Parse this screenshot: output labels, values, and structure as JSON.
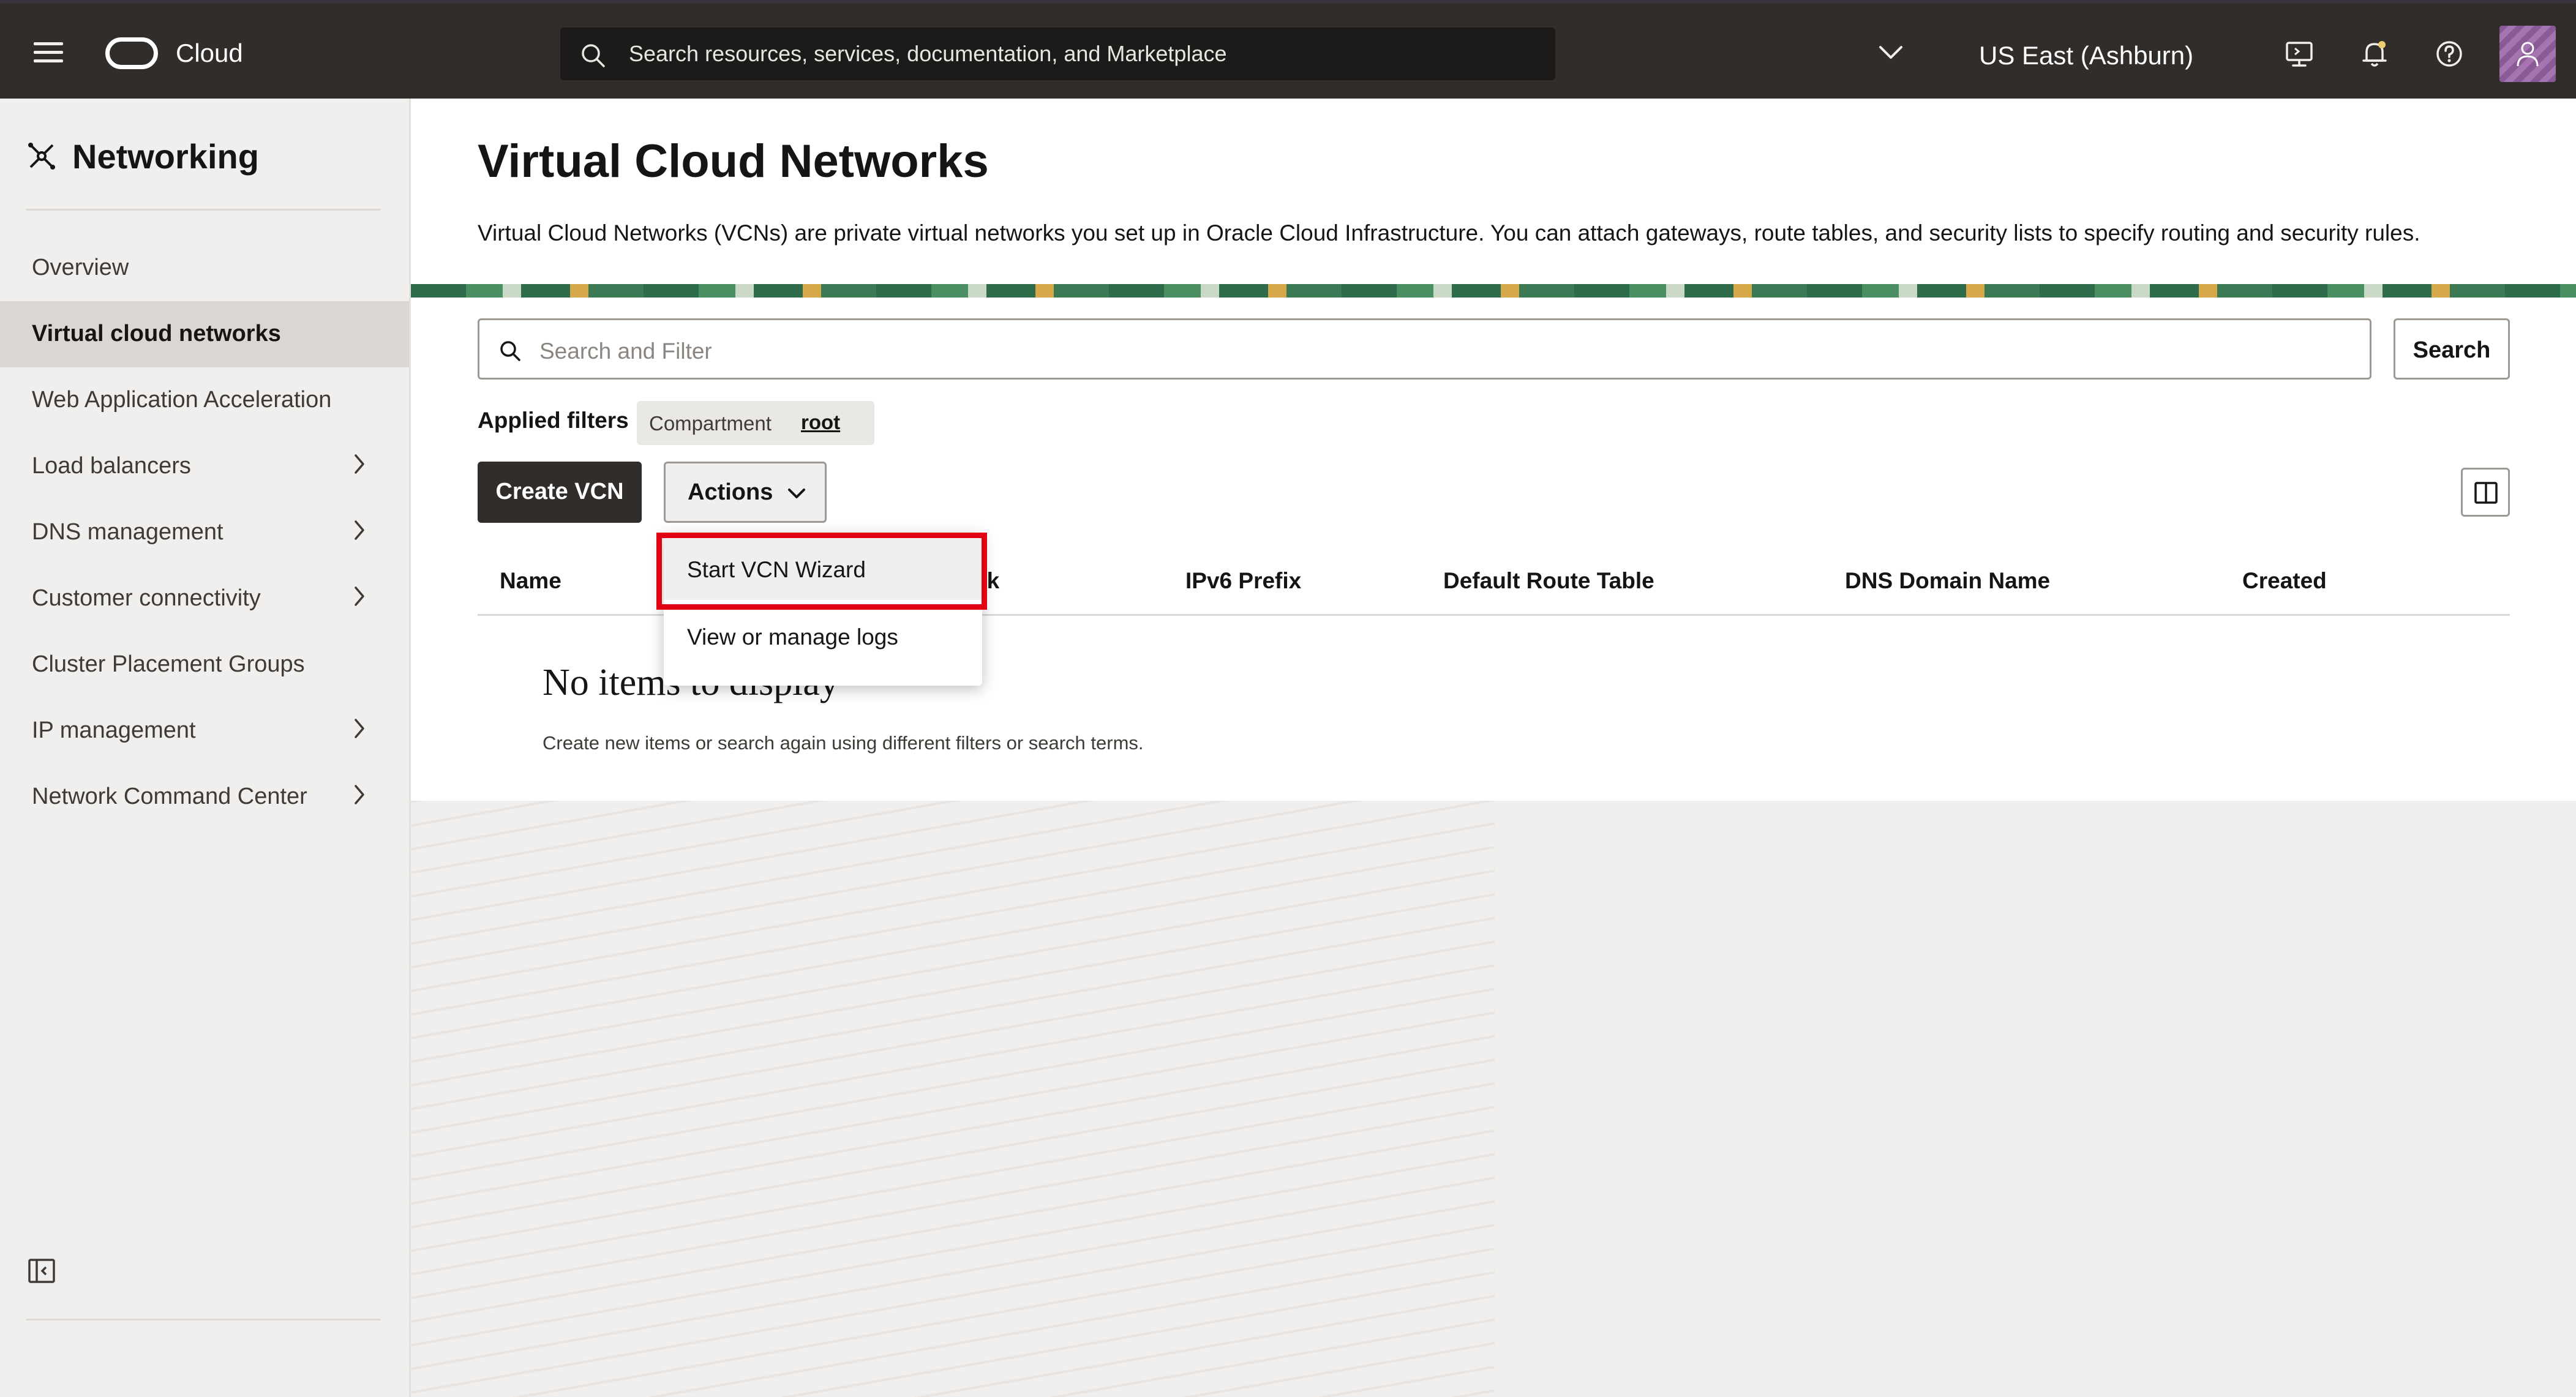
{
  "topbar": {
    "brand": "Cloud",
    "search_placeholder": "Search resources, services, documentation, and Marketplace",
    "region": "US East (Ashburn)",
    "icons": [
      "menu-icon",
      "oracle-logo-icon",
      "search-icon",
      "chevron-down-icon",
      "cloud-shell-icon",
      "bell-icon",
      "help-icon",
      "user-avatar-icon"
    ]
  },
  "sidebar": {
    "title": "Networking",
    "items": [
      {
        "label": "Overview",
        "has_submenu": false
      },
      {
        "label": "Virtual cloud networks",
        "has_submenu": false,
        "active": true
      },
      {
        "label": "Web Application Acceleration",
        "has_submenu": false
      },
      {
        "label": "Load balancers",
        "has_submenu": true
      },
      {
        "label": "DNS management",
        "has_submenu": true
      },
      {
        "label": "Customer connectivity",
        "has_submenu": true
      },
      {
        "label": "Cluster Placement Groups",
        "has_submenu": false
      },
      {
        "label": "IP management",
        "has_submenu": true
      },
      {
        "label": "Network Command Center",
        "has_submenu": true
      }
    ]
  },
  "main": {
    "title": "Virtual Cloud Networks",
    "description": "Virtual Cloud Networks (VCNs) are private virtual networks you set up in Oracle Cloud Infrastructure. You can attach gateways, route tables, and security lists to specify routing and security rules.",
    "filter_placeholder": "Search and Filter",
    "search_button": "Search",
    "applied_filters_label": "Applied filters",
    "filter_chip": {
      "key": "Compartment",
      "value": "root"
    },
    "create_button": "Create VCN",
    "actions_button": "Actions",
    "columns": [
      "Name",
      "ck",
      "IPv6 Prefix",
      "Default Route Table",
      "DNS Domain Name",
      "Created"
    ],
    "empty_title": "No items to display",
    "empty_subtitle": "Create new items or search again using different filters or search terms."
  },
  "actions_menu": {
    "items": [
      "Start VCN Wizard",
      "View or manage logs"
    ],
    "highlighted": "Start VCN Wizard"
  },
  "colors": {
    "topbar": "#312d2a",
    "highlight": "#e10014",
    "primary_button": "#312d2a"
  }
}
